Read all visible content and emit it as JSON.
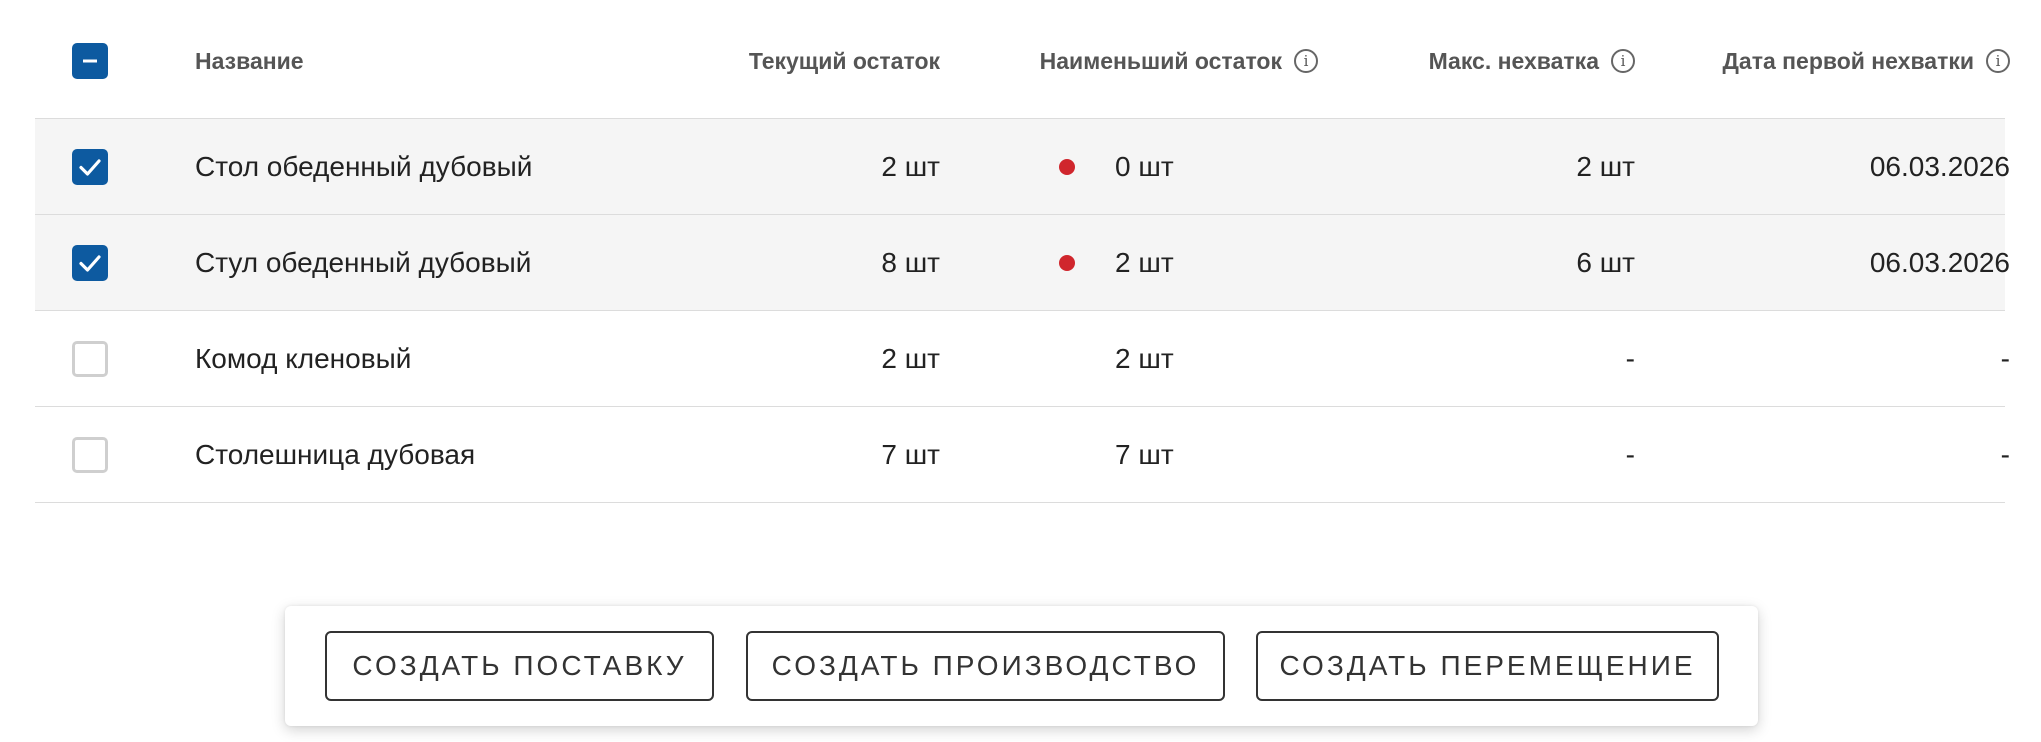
{
  "header": {
    "name": "Название",
    "current_stock": "Текущий остаток",
    "min_stock": "Наименьший остаток",
    "max_shortage": "Макс. нехватка",
    "first_shortage_date": "Дата первой нехватки",
    "info_icon": "i"
  },
  "rows": [
    {
      "name": "Стол обеденный дубовый",
      "current": "2 шт",
      "min": "0 шт",
      "max_shortage": "2 шт",
      "date": "06.03.2026",
      "selected": true,
      "warning": true
    },
    {
      "name": "Стул обеденный дубовый",
      "current": "8 шт",
      "min": "2 шт",
      "max_shortage": "6 шт",
      "date": "06.03.2026",
      "selected": true,
      "warning": true
    },
    {
      "name": "Комод кленовый",
      "current": "2 шт",
      "min": "2 шт",
      "max_shortage": "-",
      "date": "-",
      "selected": false,
      "warning": false
    },
    {
      "name": "Столешница дубовая",
      "current": "7 шт",
      "min": "7 шт",
      "max_shortage": "-",
      "date": "-",
      "selected": false,
      "warning": false
    }
  ],
  "actions": {
    "create_supply": "СОЗДАТЬ ПОСТАВКУ",
    "create_production": "СОЗДАТЬ ПРОИЗВОДСТВО",
    "create_transfer": "СОЗДАТЬ ПЕРЕМЕЩЕНИЕ"
  },
  "colors": {
    "accent": "#0d5aa0",
    "warning_dot": "#d0262d",
    "selected_row": "#f5f5f5"
  }
}
